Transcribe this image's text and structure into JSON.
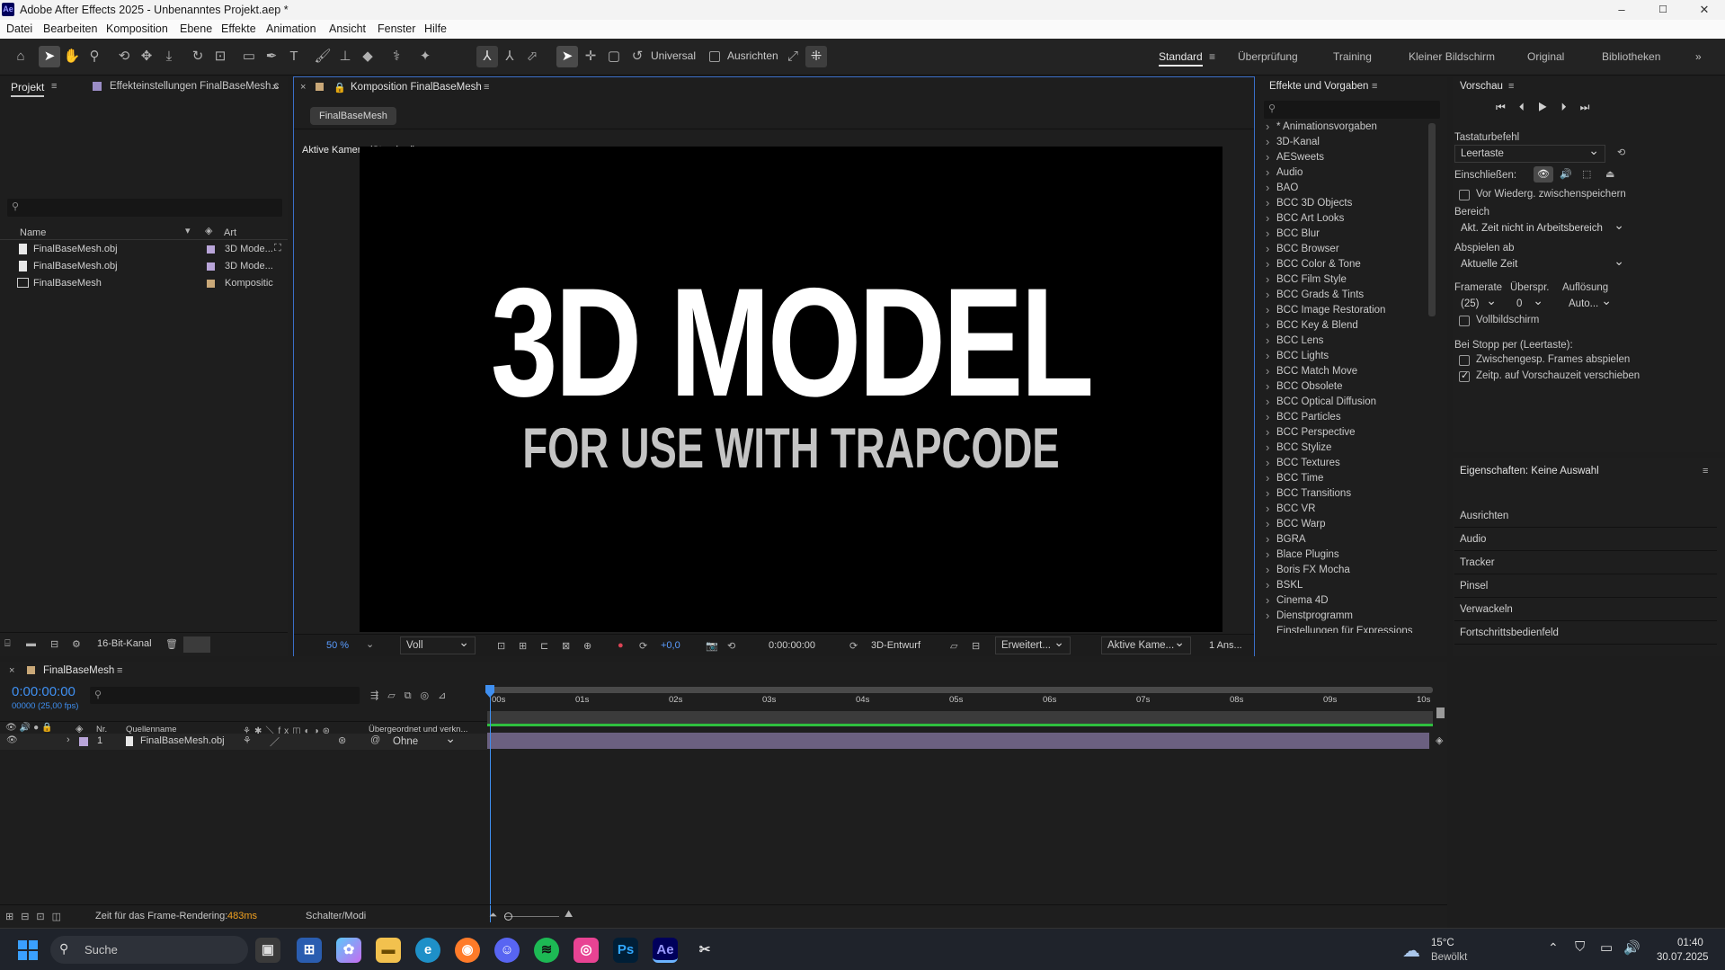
{
  "app": {
    "logo": "Ae",
    "title": "Adobe After Effects 2025 - Unbenanntes Projekt.aep *"
  },
  "window_controls": {
    "minimize": "–",
    "maximize": "☐",
    "close": "✕"
  },
  "menu": [
    "Datei",
    "Bearbeiten",
    "Komposition",
    "Ebene",
    "Effekte",
    "Animation",
    "Ansicht",
    "Fenster",
    "Hilfe"
  ],
  "toolbar": {
    "universal_label": "Universal",
    "align_label": "Ausrichten"
  },
  "workspaces": [
    "Standard",
    "Überprüfung",
    "Training",
    "Kleiner Bildschirm",
    "Original",
    "Bibliotheken"
  ],
  "project_panel": {
    "tab_project": "Projekt",
    "tab_effects": "Effekteinstellungen FinalBaseMesh.c",
    "col_name": "Name",
    "col_type": "Art",
    "items": [
      {
        "name": "FinalBaseMesh.obj",
        "type": "3D Mode...",
        "color": "#b9a5d9"
      },
      {
        "name": "FinalBaseMesh.obj",
        "type": "3D Mode...",
        "color": "#b9a5d9"
      },
      {
        "name": "FinalBaseMesh",
        "type": "Kompositic",
        "color": "#c9a878"
      }
    ],
    "bit_depth": "16-Bit-Kanal"
  },
  "composition": {
    "tab_title": "Komposition FinalBaseMesh",
    "subtab": "FinalBaseMesh",
    "camera_label": "Aktive Kamera (Standard)",
    "headline": "3D MODEL",
    "subline": "FOR USE WITH TRAPCODE",
    "zoom": "50 %",
    "resolution": "Voll",
    "exposure": "+0,0",
    "timecode": "0:00:00:00",
    "renderer": "3D-Entwurf",
    "extended": "Erweitert...",
    "camera_select": "Aktive Kame...",
    "views": "1 Ans..."
  },
  "effects_panel": {
    "title": "Effekte und Vorgaben",
    "items": [
      "* Animationsvorgaben",
      "3D-Kanal",
      "AESweets",
      "Audio",
      "BAO",
      "BCC 3D Objects",
      "BCC Art Looks",
      "BCC Blur",
      "BCC Browser",
      "BCC Color & Tone",
      "BCC Film Style",
      "BCC Grads & Tints",
      "BCC Image Restoration",
      "BCC Key & Blend",
      "BCC Lens",
      "BCC Lights",
      "BCC Match Move",
      "BCC Obsolete",
      "BCC Optical Diffusion",
      "BCC Particles",
      "BCC Perspective",
      "BCC Stylize",
      "BCC Textures",
      "BCC Time",
      "BCC Transitions",
      "BCC VR",
      "BCC Warp",
      "BGRA",
      "Blace Plugins",
      "Boris FX Mocha",
      "BSKL",
      "Cinema 4D",
      "Dienstprogramm",
      "Einstellungen für Expressions"
    ]
  },
  "preview_panel": {
    "title": "Vorschau",
    "shortcut_label": "Tastaturbefehl",
    "shortcut_value": "Leertaste",
    "include_label": "Einschließen:",
    "cache_label": "Vor Wiederg. zwischenspeichern",
    "range_label": "Bereich",
    "range_value": "Akt. Zeit nicht in Arbeitsbereich",
    "play_from_label": "Abspielen ab",
    "play_from_value": "Aktuelle Zeit",
    "framerate_label": "Framerate",
    "skip_label": "Überspr.",
    "resolution_label": "Auflösung",
    "framerate_value": "(25)",
    "skip_value": "0",
    "resolution_value": "Auto...",
    "fullscreen_label": "Vollbildschirm",
    "on_stop_label": "Bei Stopp per (Leertaste):",
    "cached_frames_label": "Zwischengesp. Frames abspielen",
    "move_time_label": "Zeitp. auf Vorschauzeit verschieben"
  },
  "properties_panel": {
    "title": "Eigenschaften: Keine Auswahl",
    "items": [
      "Ausrichten",
      "Audio",
      "Tracker",
      "Pinsel",
      "Verwackeln",
      "Fortschrittsbedienfeld"
    ]
  },
  "timeline": {
    "tab": "FinalBaseMesh",
    "timecode": "0:00:00:00",
    "fps_label": "00000 (25,00 fps)",
    "col_nr": "Nr.",
    "col_source": "Quellenname",
    "col_parent": "Übergeordnet und verkn...",
    "ruler": [
      "00s",
      "01s",
      "02s",
      "03s",
      "04s",
      "05s",
      "06s",
      "07s",
      "08s",
      "09s",
      "10s"
    ],
    "layer": {
      "nr": "1",
      "name": "FinalBaseMesh.obj",
      "parent": "Ohne"
    },
    "render_time_label": "Zeit für das Frame-Rendering:",
    "render_time_value": "483ms",
    "switches_label": "Schalter/Modi"
  },
  "taskbar": {
    "search_placeholder": "Suche",
    "weather_temp": "15°C",
    "weather_desc": "Bewölkt",
    "time": "01:40",
    "date": "30.07.2025"
  }
}
